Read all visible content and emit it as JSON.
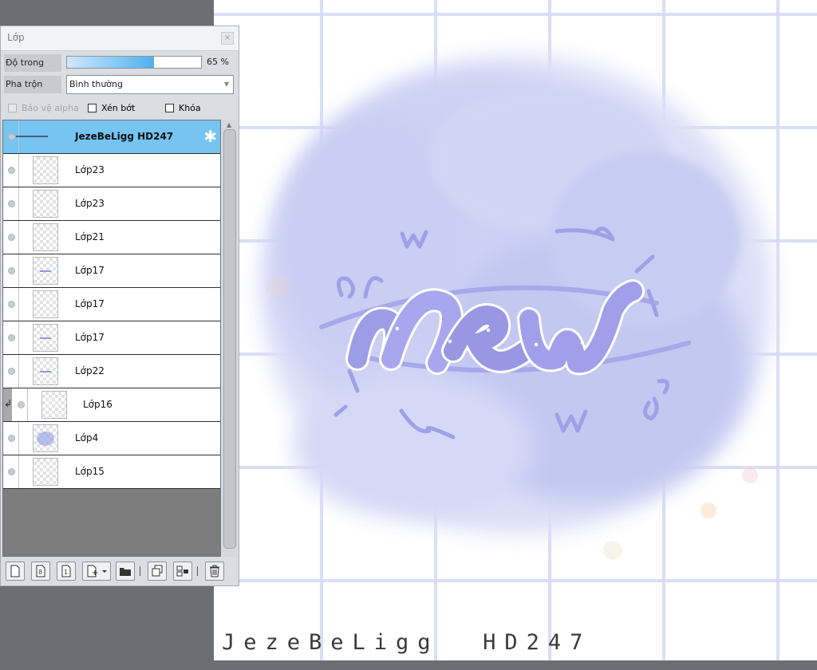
{
  "panel": {
    "title": "Lớp",
    "close_glyph": "×",
    "opacity_label": "Độ trong",
    "opacity_value": "65 %",
    "opacity_fraction": 0.65,
    "blend_label": "Pha trộn",
    "blend_value": "Bình thường",
    "protect_alpha_label": "Bảo vệ alpha",
    "clip_label": "Xén bớt",
    "lock_label": "Khóa"
  },
  "layers": [
    {
      "name": "JezeBeLigg  HD247",
      "selected": true
    },
    {
      "name": "Lớp23"
    },
    {
      "name": "Lớp23"
    },
    {
      "name": "Lớp21"
    },
    {
      "name": "Lớp17"
    },
    {
      "name": "Lớp17"
    },
    {
      "name": "Lớp17"
    },
    {
      "name": "Lớp22"
    },
    {
      "name": "Lớp16",
      "clipped": true
    },
    {
      "name": "Lớp4"
    },
    {
      "name": "Lớp15"
    }
  ],
  "canvas": {
    "watermark": "JezeBeLigg  HD247"
  },
  "colors": {
    "selected_layer": "#75c4f2",
    "lettering": "#9c9ce8",
    "watercolor": "#c9cdf3"
  },
  "icons": [
    "new-raster-layer-icon",
    "new-8bit-layer-icon",
    "new-1bit-layer-icon",
    "new-vector-layer-icon",
    "new-folder-icon",
    "duplicate-layer-icon",
    "merge-down-icon",
    "trash-icon",
    "gear-icon",
    "eye-icon"
  ]
}
